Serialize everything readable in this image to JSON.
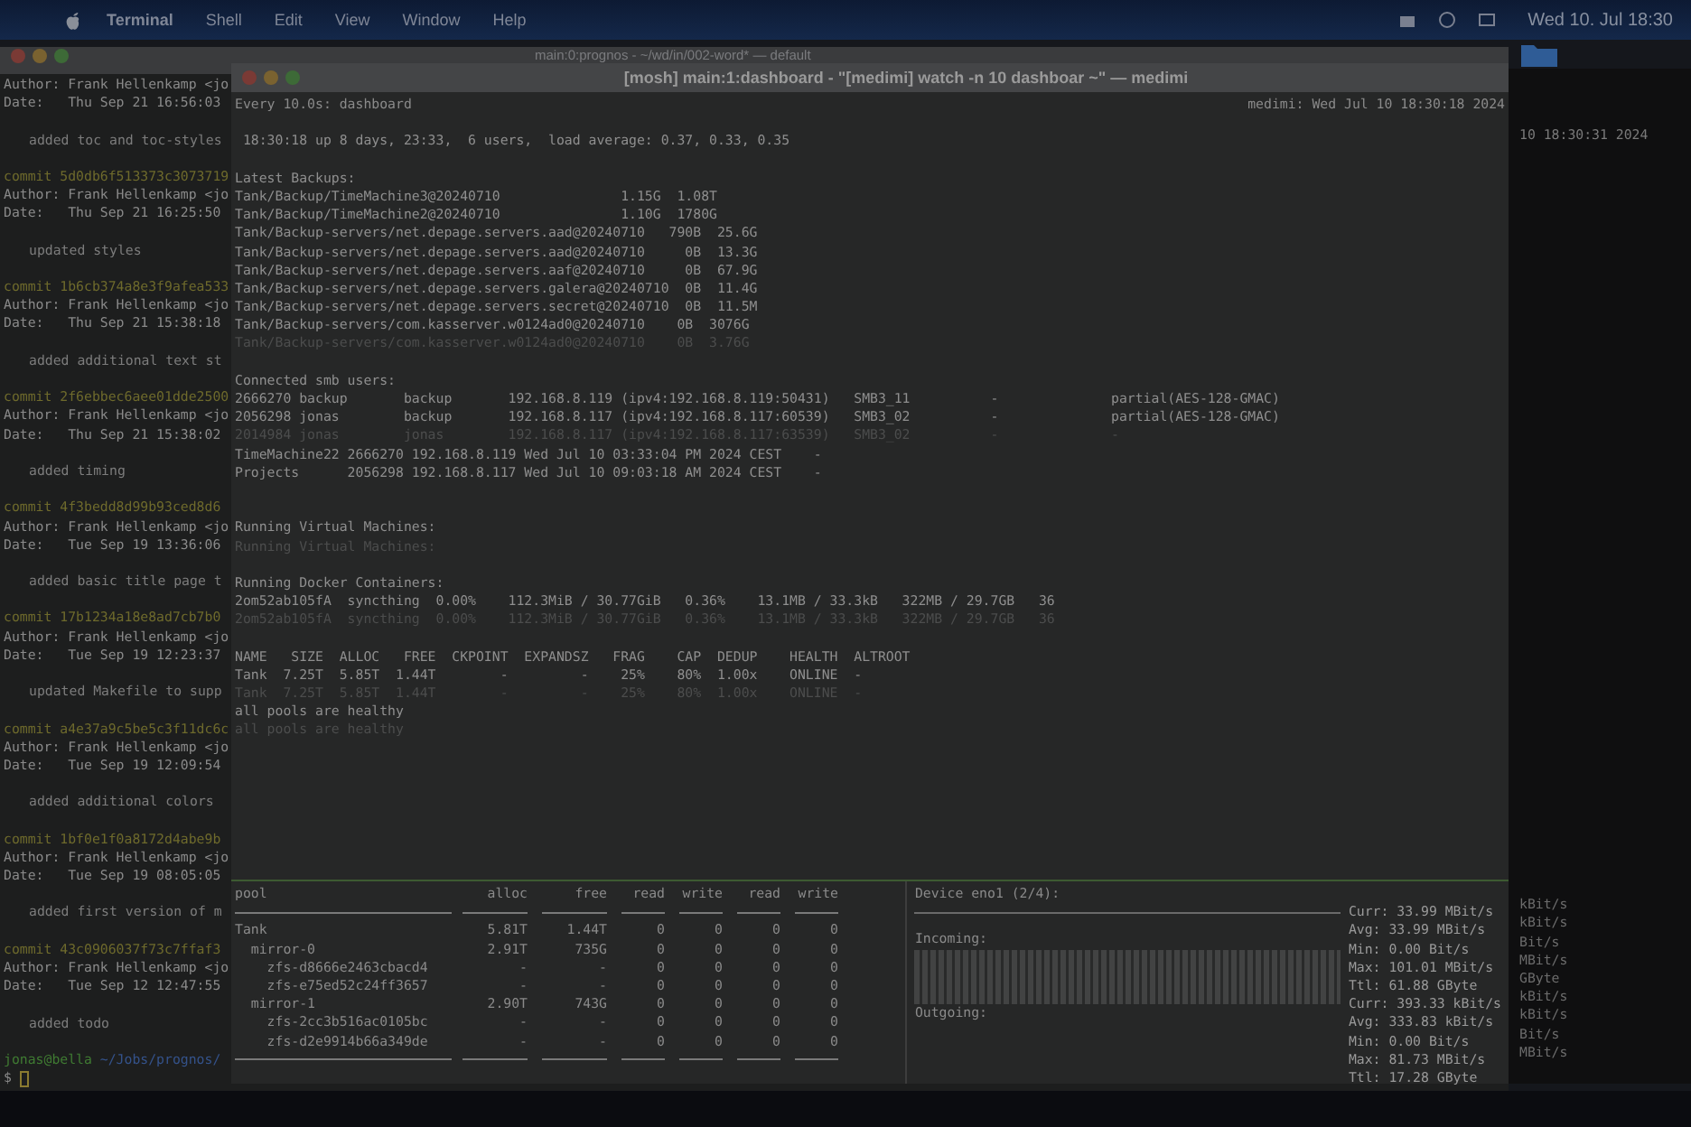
{
  "menu_bar": {
    "items": [
      "Terminal",
      "Shell",
      "Edit",
      "View",
      "Window",
      "Help"
    ],
    "clock": "Wed 10. Jul 18:30"
  },
  "back_terminal": {
    "title": "main:0:prognos - ~/wd/in/002-word* — default",
    "log": [
      {
        "kind": "author",
        "text": "Author: Frank Hellenkamp <jo"
      },
      {
        "kind": "date",
        "text": "Date:   Thu Sep 21 16:56:03"
      },
      {
        "kind": "blank"
      },
      {
        "kind": "message",
        "text": "added toc and toc-styles"
      },
      {
        "kind": "blank"
      },
      {
        "kind": "commit",
        "text": "commit 5d0db6f513373c3073719"
      },
      {
        "kind": "author",
        "text": "Author: Frank Hellenkamp <jo"
      },
      {
        "kind": "date",
        "text": "Date:   Thu Sep 21 16:25:50"
      },
      {
        "kind": "blank"
      },
      {
        "kind": "message",
        "text": "updated styles"
      },
      {
        "kind": "blank"
      },
      {
        "kind": "commit",
        "text": "commit 1b6cb374a8e3f9afea533"
      },
      {
        "kind": "author",
        "text": "Author: Frank Hellenkamp <jo"
      },
      {
        "kind": "date",
        "text": "Date:   Thu Sep 21 15:38:18"
      },
      {
        "kind": "blank"
      },
      {
        "kind": "message",
        "text": "added additional text st"
      },
      {
        "kind": "blank"
      },
      {
        "kind": "commit",
        "text": "commit 2f6ebbec6aee01dde2500"
      },
      {
        "kind": "author",
        "text": "Author: Frank Hellenkamp <jo"
      },
      {
        "kind": "date",
        "text": "Date:   Thu Sep 21 15:38:02"
      },
      {
        "kind": "blank"
      },
      {
        "kind": "message",
        "text": "added timing"
      },
      {
        "kind": "blank"
      },
      {
        "kind": "commit",
        "text": "commit 4f3bedd8d99b93ced8d6"
      },
      {
        "kind": "author",
        "text": "Author: Frank Hellenkamp <jo"
      },
      {
        "kind": "date",
        "text": "Date:   Tue Sep 19 13:36:06"
      },
      {
        "kind": "blank"
      },
      {
        "kind": "message",
        "text": "added basic title page t"
      },
      {
        "kind": "blank"
      },
      {
        "kind": "commit",
        "text": "commit 17b1234a18e8ad7cb7b0"
      },
      {
        "kind": "author",
        "text": "Author: Frank Hellenkamp <jo"
      },
      {
        "kind": "date",
        "text": "Date:   Tue Sep 19 12:23:37"
      },
      {
        "kind": "blank"
      },
      {
        "kind": "message",
        "text": "updated Makefile to supp"
      },
      {
        "kind": "blank"
      },
      {
        "kind": "commit",
        "text": "commit a4e37a9c5be5c3f11dc6c"
      },
      {
        "kind": "author",
        "text": "Author: Frank Hellenkamp <jo"
      },
      {
        "kind": "date",
        "text": "Date:   Tue Sep 19 12:09:54"
      },
      {
        "kind": "blank"
      },
      {
        "kind": "message",
        "text": "added additional colors"
      },
      {
        "kind": "blank"
      },
      {
        "kind": "commit",
        "text": "commit 1bf0e1f0a8172d4abe9b"
      },
      {
        "kind": "author",
        "text": "Author: Frank Hellenkamp <jo"
      },
      {
        "kind": "date",
        "text": "Date:   Tue Sep 19 08:05:05"
      },
      {
        "kind": "blank"
      },
      {
        "kind": "message",
        "text": "added first version of m"
      },
      {
        "kind": "blank"
      },
      {
        "kind": "commit",
        "text": "commit 43c0906037f73c7ffaf3"
      },
      {
        "kind": "author",
        "text": "Author: Frank Hellenkamp <jo"
      },
      {
        "kind": "date",
        "text": "Date:   Tue Sep 12 12:47:55"
      },
      {
        "kind": "blank"
      },
      {
        "kind": "message",
        "text": "added todo"
      },
      {
        "kind": "blank"
      }
    ],
    "prompt": {
      "user": "jonas@bella",
      "path": "~/Jobs/prognos/",
      "symbol": "$"
    }
  },
  "dashboard": {
    "title": "[mosh] main:1:dashboard - \"[medimi] watch -n 10 dashboar ~\" — medimi",
    "header_left": "Every 10.0s: dashboard",
    "header_right": "medimi: Wed Jul 10 18:30:18 2024",
    "lines": [
      {
        "kind": "blank"
      },
      {
        "kind": "text",
        "dim": false,
        "text": " 18:30:18 up 8 days, 23:33,  6 users,  load average: 0.37, 0.33, 0.35"
      },
      {
        "kind": "blank"
      },
      {
        "kind": "text",
        "dim": false,
        "text": "Latest Backups:"
      },
      {
        "kind": "text",
        "dim": false,
        "text": "Tank/Backup/TimeMachine3@20240710               1.15G  1.08T"
      },
      {
        "kind": "text",
        "dim": false,
        "text": "Tank/Backup/TimeMachine2@20240710               1.10G  1780G"
      },
      {
        "kind": "text",
        "dim": false,
        "text": "Tank/Backup-servers/net.depage.servers.aad@20240710   790B  25.6G"
      },
      {
        "kind": "text",
        "dim": false,
        "text": "Tank/Backup-servers/net.depage.servers.aad@20240710     0B  13.3G"
      },
      {
        "kind": "text",
        "dim": false,
        "text": "Tank/Backup-servers/net.depage.servers.aaf@20240710     0B  67.9G"
      },
      {
        "kind": "text",
        "dim": false,
        "text": "Tank/Backup-servers/net.depage.servers.galera@20240710  0B  11.4G"
      },
      {
        "kind": "text",
        "dim": false,
        "text": "Tank/Backup-servers/net.depage.servers.secret@20240710  0B  11.5M"
      },
      {
        "kind": "text",
        "dim": false,
        "text": "Tank/Backup-servers/com.kasserver.w0124ad0@20240710    0B  3076G"
      },
      {
        "kind": "text",
        "dim": true,
        "text": "Tank/Backup-servers/com.kasserver.w0124ad0@20240710    0B  3.76G"
      },
      {
        "kind": "blank"
      },
      {
        "kind": "text",
        "dim": false,
        "text": "Connected smb users:"
      },
      {
        "kind": "text",
        "dim": false,
        "text": "2666270 backup       backup       192.168.8.119 (ipv4:192.168.8.119:50431)   SMB3_11          -              partial(AES-128-GMAC)"
      },
      {
        "kind": "text",
        "dim": false,
        "text": "2056298 jonas        backup       192.168.8.117 (ipv4:192.168.8.117:60539)   SMB3_02          -              partial(AES-128-GMAC)"
      },
      {
        "kind": "text",
        "dim": true,
        "text": "2014984 jonas        jonas        192.168.8.117 (ipv4:192.168.8.117:63539)   SMB3_02          -              -"
      },
      {
        "kind": "text",
        "dim": false,
        "text": "TimeMachine22 2666270 192.168.8.119 Wed Jul 10 03:33:04 PM 2024 CEST    -"
      },
      {
        "kind": "text",
        "dim": false,
        "text": "Projects      2056298 192.168.8.117 Wed Jul 10 09:03:18 AM 2024 CEST    -"
      },
      {
        "kind": "blank"
      },
      {
        "kind": "blank"
      },
      {
        "kind": "text",
        "dim": false,
        "text": "Running Virtual Machines:"
      },
      {
        "kind": "text",
        "dim": true,
        "text": "Running Virtual Machines:"
      },
      {
        "kind": "blank"
      },
      {
        "kind": "text",
        "dim": false,
        "text": "Running Docker Containers:"
      },
      {
        "kind": "text",
        "dim": false,
        "text": "2om52ab105fA  syncthing  0.00%    112.3MiB / 30.77GiB   0.36%    13.1MB / 33.3kB   322MB / 29.7GB   36"
      },
      {
        "kind": "text",
        "dim": true,
        "text": "2om52ab105fA  syncthing  0.00%    112.3MiB / 30.77GiB   0.36%    13.1MB / 33.3kB   322MB / 29.7GB   36"
      },
      {
        "kind": "blank"
      },
      {
        "kind": "text",
        "dim": false,
        "text": "NAME   SIZE  ALLOC   FREE  CKPOINT  EXPANDSZ   FRAG    CAP  DEDUP    HEALTH  ALTROOT"
      },
      {
        "kind": "text",
        "dim": false,
        "text": "Tank  7.25T  5.85T  1.44T        -         -    25%    80%  1.00x    ONLINE  -"
      },
      {
        "kind": "text",
        "dim": true,
        "text": "Tank  7.25T  5.85T  1.44T        -         -    25%    80%  1.00x    ONLINE  -"
      },
      {
        "kind": "text",
        "dim": false,
        "text": "all pools are healthy"
      },
      {
        "kind": "text",
        "dim": true,
        "text": "all pools are healthy"
      }
    ],
    "pool_table": {
      "columns": [
        "pool",
        "alloc",
        "free",
        "read",
        "write",
        "read",
        "write"
      ],
      "rows": [
        [
          "Tank",
          "5.81T",
          "1.44T",
          "0",
          "0",
          "0",
          "0"
        ],
        [
          "  mirror-0",
          "2.91T",
          "735G",
          "0",
          "0",
          "0",
          "0"
        ],
        [
          "    zfs-d8666e2463cbacd4",
          "-",
          "-",
          "0",
          "0",
          "0",
          "0"
        ],
        [
          "    zfs-e75ed52c24ff3657",
          "-",
          "-",
          "0",
          "0",
          "0",
          "0"
        ],
        [
          "  mirror-1",
          "2.90T",
          "743G",
          "0",
          "0",
          "0",
          "0"
        ],
        [
          "    zfs-2cc3b516ac0105bc",
          "-",
          "-",
          "0",
          "0",
          "0",
          "0"
        ],
        [
          "    zfs-d2e9914b66a349de",
          "-",
          "-",
          "0",
          "0",
          "0",
          "0"
        ]
      ]
    },
    "network": {
      "device": "Device eno1 (2/4):",
      "incoming_label": "Incoming:",
      "outgoing_label": "Outgoing:",
      "incoming_stats": [
        "Curr: 33.99 MBit/s",
        "Avg: 33.99 MBit/s",
        "Min: 0.00 Bit/s",
        "Max: 101.01 MBit/s",
        "Ttl: 61.88 GByte"
      ],
      "outgoing_stats": [
        "Curr: 393.33 kBit/s",
        "Avg: 333.83 kBit/s",
        "Min: 0.00 Bit/s",
        "Max: 81.73 MBit/s",
        "Ttl: 17.28 GByte"
      ]
    }
  },
  "side_terminal": {
    "clock": "10 18:30:31 2024",
    "units": [
      "kBit/s",
      "kBit/s",
      "Bit/s",
      "MBit/s",
      "GByte",
      "kBit/s",
      "kBit/s",
      "Bit/s",
      "MBit/s"
    ]
  }
}
